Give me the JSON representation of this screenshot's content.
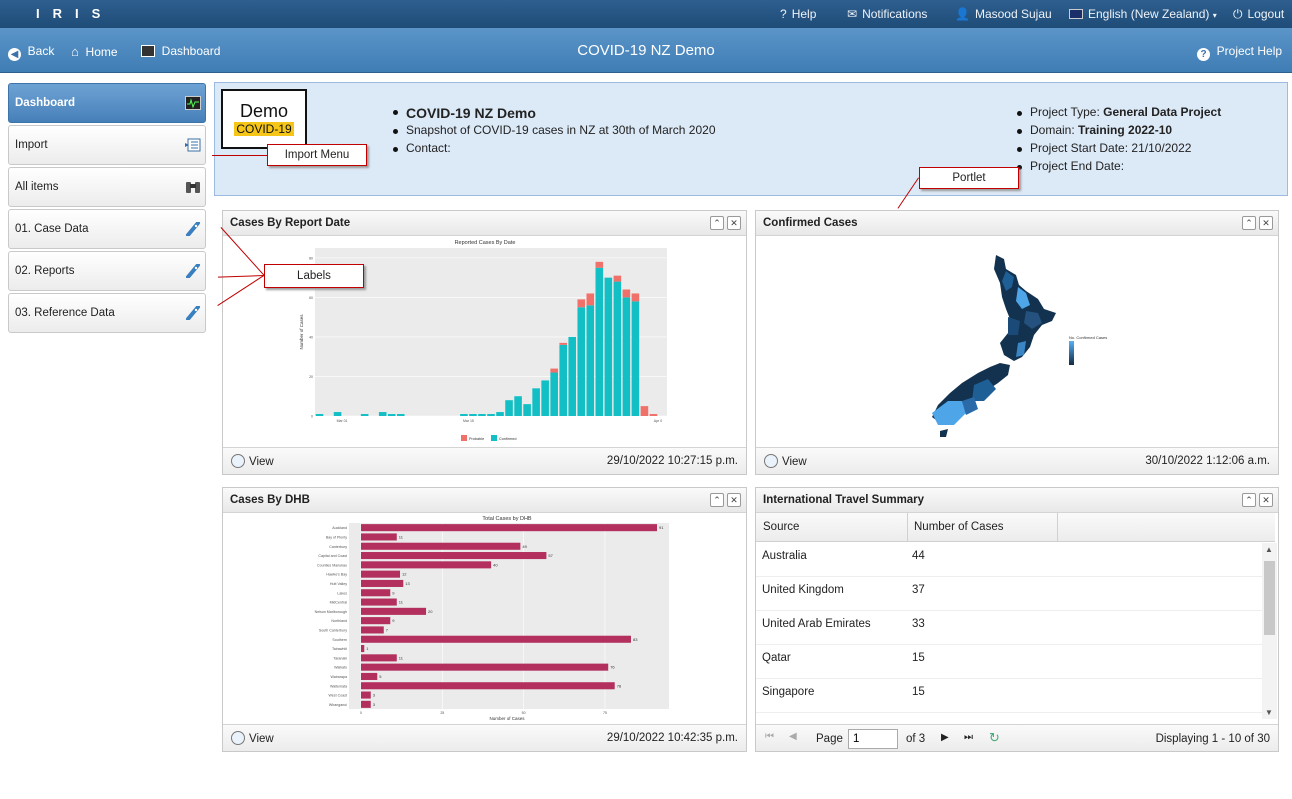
{
  "topbar": {
    "logo": "IRIS",
    "help": "Help",
    "notifications": "Notifications",
    "user": "Masood Sujau",
    "language": "English (New Zealand)",
    "logout": "Logout"
  },
  "nav": {
    "back": "Back",
    "home": "Home",
    "dashboard": "Dashboard",
    "title": "COVID-19 NZ Demo",
    "project_help": "Project Help"
  },
  "sidebar": {
    "items": [
      {
        "label": "Dashboard"
      },
      {
        "label": "Import"
      },
      {
        "label": "All items"
      },
      {
        "label": "01. Case Data"
      },
      {
        "label": "02. Reports"
      },
      {
        "label": "03. Reference Data"
      }
    ]
  },
  "project": {
    "logo_line1": "Demo",
    "logo_line2": "COVID-19",
    "name": "COVID-19 NZ Demo",
    "snapshot": "Snapshot of COVID-19 cases in NZ at 30th of March 2020",
    "contact_label": "Contact:",
    "type_label": "Project Type:",
    "type_value": "General Data Project",
    "domain_label": "Domain:",
    "domain_value": "Training 2022-10",
    "start_label": "Project Start Date:",
    "start_value": "21/10/2022",
    "end_label": "Project End Date:"
  },
  "callouts": {
    "import_menu": "Import Menu",
    "portlet": "Portlet",
    "labels": "Labels"
  },
  "portlets": {
    "report_date": {
      "title": "Cases By Report Date",
      "view": "View",
      "timestamp": "29/10/2022 10:27:15 p.m."
    },
    "confirmed": {
      "title": "Confirmed Cases",
      "view": "View",
      "timestamp": "30/10/2022 1:12:06 a.m."
    },
    "dhb": {
      "title": "Cases By DHB",
      "view": "View",
      "timestamp": "29/10/2022 10:42:35 p.m."
    },
    "travel": {
      "title": "International Travel Summary",
      "columns": [
        "Source",
        "Number of Cases"
      ],
      "rows": [
        {
          "source": "Australia",
          "cases": "44"
        },
        {
          "source": "United Kingdom",
          "cases": "37"
        },
        {
          "source": "United Arab Emirates",
          "cases": "33"
        },
        {
          "source": "Qatar",
          "cases": "15"
        },
        {
          "source": "Singapore",
          "cases": "15"
        }
      ],
      "page_label": "Page",
      "page_value": "1",
      "of_pages": "of 3",
      "displaying": "Displaying 1 - 10 of 30"
    }
  },
  "colors": {
    "confirmed": "#12bfc4",
    "probable": "#f0716a",
    "dhb_bar": "#b3305e",
    "map_dark": "#13324f",
    "map_light": "#4ea6e8"
  },
  "chart_data": [
    {
      "type": "bar",
      "title": "Reported Cases By Date",
      "ylabel": "Number of Cases",
      "xlabel": "",
      "xticks": [
        "Mar 01",
        "Mar 15",
        "Apr 0"
      ],
      "yticks": [
        0,
        20,
        40,
        60,
        80
      ],
      "ylim": [
        0,
        85
      ],
      "legend": "bottom",
      "series": [
        {
          "name": "Probable",
          "values": [
            0,
            0,
            0,
            0,
            0,
            0,
            0,
            0,
            0,
            0,
            0,
            0,
            0,
            0,
            0,
            0,
            0,
            0,
            0,
            0,
            0,
            0,
            0,
            0,
            0,
            0,
            2,
            1,
            0,
            4,
            6,
            3,
            0,
            3,
            4,
            4,
            5,
            1,
            0
          ]
        },
        {
          "name": "Confirmed",
          "values": [
            1,
            0,
            2,
            0,
            0,
            1,
            0,
            2,
            1,
            1,
            0,
            0,
            0,
            0,
            0,
            0,
            1,
            1,
            1,
            1,
            2,
            8,
            10,
            6,
            14,
            18,
            22,
            36,
            40,
            55,
            56,
            75,
            70,
            68,
            60,
            58,
            0,
            0,
            0
          ]
        }
      ],
      "categories": [
        "1",
        "2",
        "3",
        "4",
        "5",
        "6",
        "7",
        "8",
        "9",
        "10",
        "11",
        "12",
        "13",
        "14",
        "15",
        "16",
        "17",
        "18",
        "19",
        "20",
        "21",
        "22",
        "23",
        "24",
        "25",
        "26",
        "27",
        "28",
        "29",
        "30",
        "31",
        "32",
        "33",
        "34",
        "35",
        "36",
        "37",
        "38",
        "39"
      ]
    },
    {
      "type": "bar",
      "orientation": "horizontal",
      "title": "Total Cases by DHB",
      "xlabel": "Number of Cases",
      "ylabel": "",
      "xticks": [
        0,
        25,
        50,
        75
      ],
      "categories": [
        "Auckland",
        "Bay of Plenty",
        "Canterbury",
        "Capital and Coast",
        "Counties Manukau",
        "Hawke's Bay",
        "Hutt Valley",
        "Lakes",
        "MidCentral",
        "Nelson Marlborough",
        "Northland",
        "South Canterbury",
        "Southern",
        "Tairawhiti",
        "Taranaki",
        "Waikato",
        "Wairarapa",
        "Waitemata",
        "West Coast",
        "Whanganui"
      ],
      "values": [
        91,
        11,
        49,
        57,
        40,
        12,
        13,
        9,
        11,
        20,
        9,
        7,
        83,
        1,
        11,
        76,
        5,
        78,
        3,
        3
      ]
    }
  ],
  "map_data": {
    "legend_title": "No. Confirmed Cases"
  }
}
